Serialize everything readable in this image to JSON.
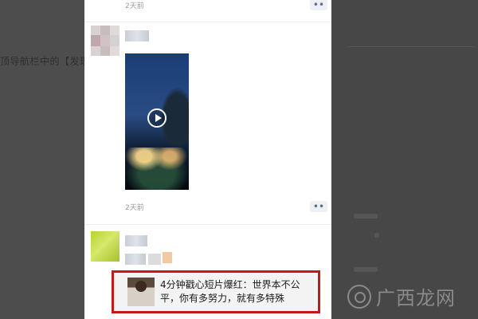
{
  "background": {
    "partial_text": "顶导航栏中的【发现"
  },
  "feed": {
    "posts": [
      {
        "time": "2天前"
      },
      {
        "time": "2天前"
      }
    ],
    "shared_article": {
      "title": "4分钟戳心短片爆红：世界本不公平，你有多努力，就有多特殊"
    }
  },
  "watermark": {
    "text": "广西龙网"
  },
  "icons": {
    "more": "more-dots-icon",
    "play": "play-icon"
  },
  "colors": {
    "highlight_border": "#c21a1a",
    "link_blue": "#576b95"
  }
}
